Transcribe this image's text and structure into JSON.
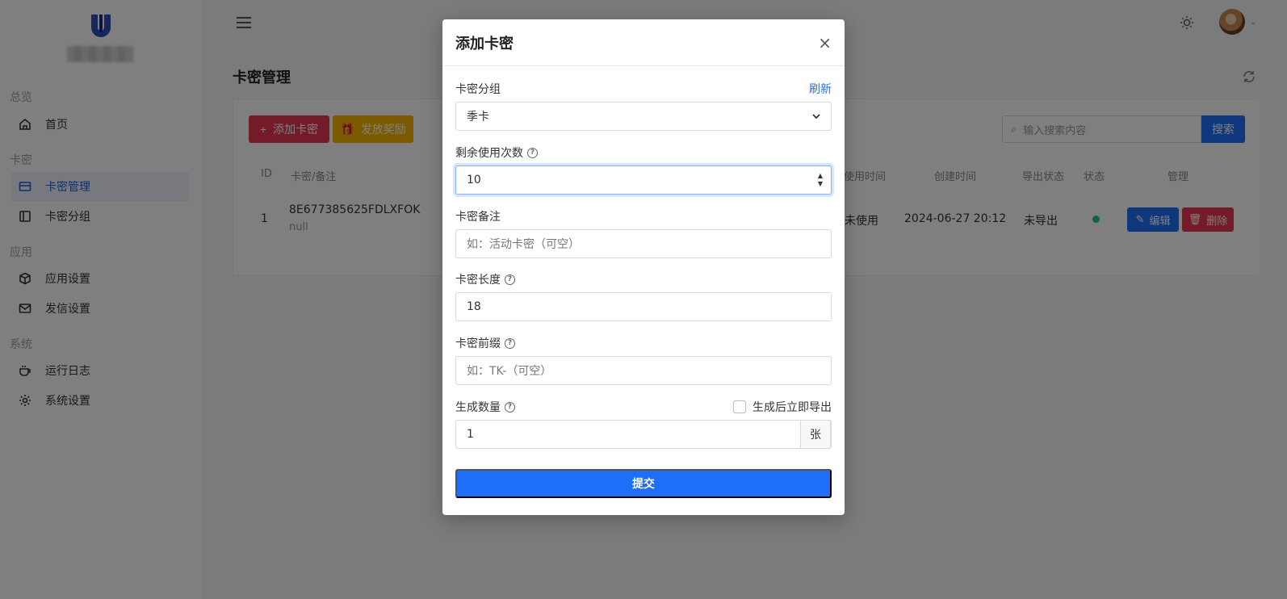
{
  "sidebar": {
    "sections": [
      {
        "label": "总览",
        "items": [
          {
            "label": "首页",
            "icon": "home-icon"
          }
        ]
      },
      {
        "label": "卡密",
        "items": [
          {
            "label": "卡密管理",
            "icon": "card-icon",
            "active": true
          },
          {
            "label": "卡密分组",
            "icon": "group-icon"
          }
        ]
      },
      {
        "label": "应用",
        "items": [
          {
            "label": "应用设置",
            "icon": "box-icon"
          },
          {
            "label": "发信设置",
            "icon": "mail-icon"
          }
        ]
      },
      {
        "label": "系统",
        "items": [
          {
            "label": "运行日志",
            "icon": "cup-icon"
          },
          {
            "label": "系统设置",
            "icon": "gear-icon"
          }
        ]
      }
    ]
  },
  "page": {
    "title": "卡密管理",
    "add_label": "添加卡密",
    "reward_label": "发放奖励",
    "search_placeholder": "输入搜索内容",
    "search_label": "搜索"
  },
  "table": {
    "headers": [
      "ID",
      "卡密/备注",
      "使用时间",
      "创建时间",
      "导出状态",
      "状态",
      "管理"
    ],
    "rows": [
      {
        "id": "1",
        "key": "8E677385625FDLXFOK",
        "note": "null",
        "used": "未使用",
        "created": "2024-06-27 20:12",
        "export": "未导出",
        "status": "active",
        "edit": "编辑",
        "delete": "删除"
      }
    ]
  },
  "modal": {
    "title": "添加卡密",
    "group_label": "卡密分组",
    "refresh_label": "刷新",
    "group_value": "季卡",
    "uses_label": "剩余使用次数",
    "uses_value": "10",
    "note_label": "卡密备注",
    "note_placeholder": "如：活动卡密（可空）",
    "length_label": "卡密长度",
    "length_value": "18",
    "prefix_label": "卡密前缀",
    "prefix_placeholder": "如：TK-（可空）",
    "count_label": "生成数量",
    "export_label": "生成后立即导出",
    "count_value": "1",
    "count_unit": "张",
    "submit_label": "提交"
  },
  "colors": {
    "primary": "#1e6ef8",
    "danger": "#e93655",
    "warning": "#f8b600",
    "success": "#21c77a"
  }
}
